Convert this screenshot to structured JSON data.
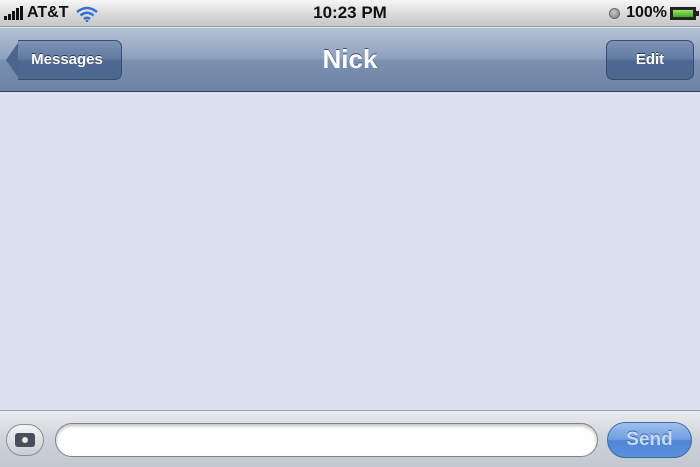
{
  "status_bar": {
    "carrier": "AT&T",
    "time": "10:23 PM",
    "battery_percent": "100%",
    "battery_level": 1.0,
    "icons": [
      "signal-icon",
      "wifi-icon",
      "lock-icon",
      "battery-icon"
    ]
  },
  "nav_bar": {
    "back_label": "Messages",
    "title": "Nick",
    "edit_label": "Edit"
  },
  "compose_bar": {
    "camera_icon": "camera-icon",
    "message_value": "",
    "message_placeholder": "",
    "send_label": "Send"
  },
  "colors": {
    "nav_bar": "#7b90b0",
    "message_background": "#dbe2ed",
    "send_button": "#5a90db"
  }
}
